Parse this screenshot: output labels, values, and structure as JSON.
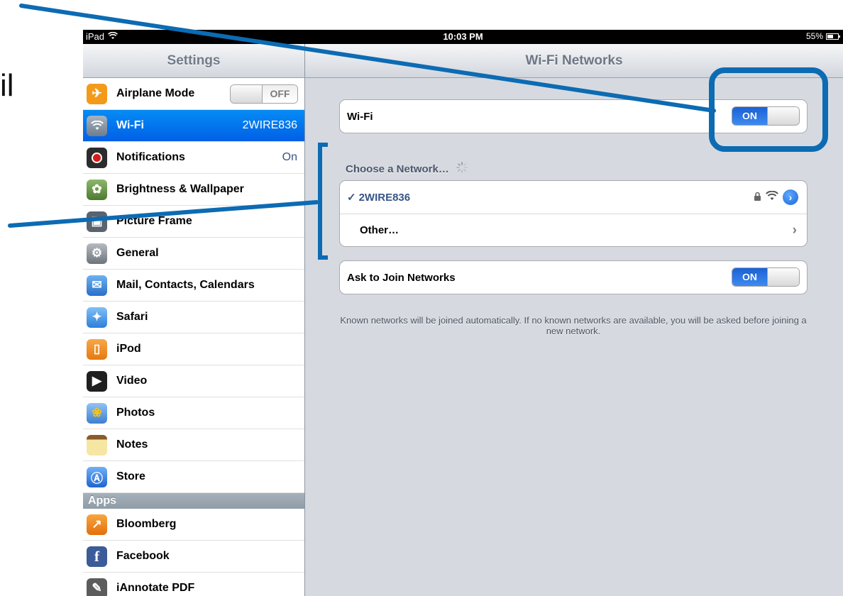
{
  "edge_text": "il",
  "status_bar": {
    "device": "iPad",
    "time": "10:03 PM",
    "battery": "55%"
  },
  "sidebar": {
    "title": "Settings",
    "items": [
      {
        "label": "Airplane Mode",
        "control": "switch",
        "state": "OFF",
        "icon": "airplane-icon",
        "color": "#f49a1a"
      },
      {
        "label": "Wi-Fi",
        "value": "2WIRE836",
        "selected": true,
        "icon": "wifi-icon",
        "color": "#8a98a6"
      },
      {
        "label": "Notifications",
        "value": "On",
        "icon": "notifications-icon",
        "color": "#d61b1b"
      },
      {
        "label": "Brightness & Wallpaper",
        "icon": "brightness-wallpaper-icon",
        "color": "#6aa04a"
      },
      {
        "label": "Picture Frame",
        "icon": "picture-frame-icon",
        "color": "#4d5b69"
      },
      {
        "label": "General",
        "icon": "gear-icon",
        "color": "#8a8f96"
      },
      {
        "label": "Mail, Contacts, Calendars",
        "icon": "mail-icon",
        "color": "#3b86d8"
      },
      {
        "label": "Safari",
        "icon": "safari-icon",
        "color": "#3d92e8"
      },
      {
        "label": "iPod",
        "icon": "ipod-icon",
        "color": "#f18b1a"
      },
      {
        "label": "Video",
        "icon": "video-icon",
        "color": "#2b2b2b"
      },
      {
        "label": "Photos",
        "icon": "photos-icon",
        "color": "#4c7fc7"
      },
      {
        "label": "Notes",
        "icon": "notes-icon",
        "color": "#f4e38c"
      },
      {
        "label": "Store",
        "icon": "store-icon",
        "color": "#2f7fe0"
      }
    ],
    "apps_header": "Apps",
    "apps": [
      {
        "label": "Bloomberg",
        "icon": "bloomberg-icon",
        "color": "#f4901c"
      },
      {
        "label": "Facebook",
        "icon": "facebook-icon",
        "color": "#3b5b99"
      },
      {
        "label": "iAnnotate PDF",
        "icon": "iannotate-icon",
        "color": "#6a6a6a"
      }
    ]
  },
  "main": {
    "title": "Wi-Fi Networks",
    "wifi": {
      "label": "Wi-Fi",
      "state": "ON"
    },
    "choose_label": "Choose a Network…",
    "networks": [
      {
        "check": "✓",
        "name": "2WIRE836"
      }
    ],
    "other_label": "Other…",
    "ask_to_join": {
      "label": "Ask to Join Networks",
      "state": "ON"
    },
    "note": "Known networks will be joined automatically.  If no known networks are available, you will be asked before joining a new network."
  },
  "colors": {
    "annotation": "#0c6bb3",
    "selection": "#0275ee",
    "switch_on": "#2a73e0"
  }
}
